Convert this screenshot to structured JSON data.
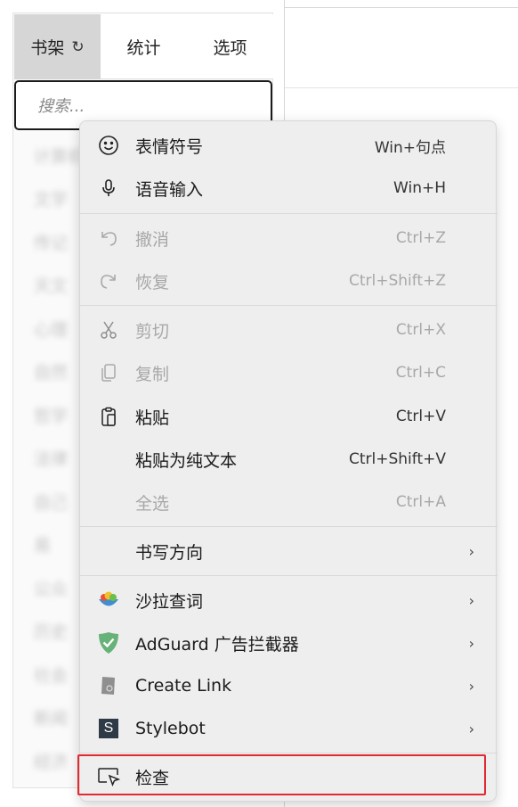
{
  "popup": {
    "tabs": [
      {
        "label": "书架",
        "refresh_glyph": "↻"
      },
      {
        "label": "统计"
      },
      {
        "label": "选项"
      }
    ],
    "search_placeholder": "搜索...",
    "list_items": [
      "计算机",
      "文学",
      "传记",
      "天文",
      "心理",
      "自然",
      "哲学",
      "法律",
      "自己",
      "易",
      "公众",
      "历史",
      "社会",
      "新闻",
      "经济"
    ]
  },
  "context_menu": {
    "items": [
      {
        "label": "表情符号",
        "shortcut": "Win+句点",
        "icon": "emoji-icon",
        "disabled": false
      },
      {
        "label": "语音输入",
        "shortcut": "Win+H",
        "icon": "microphone-icon",
        "disabled": false
      },
      {
        "label": "撤消",
        "shortcut": "Ctrl+Z",
        "icon": "undo-icon",
        "disabled": true
      },
      {
        "label": "恢复",
        "shortcut": "Ctrl+Shift+Z",
        "icon": "redo-icon",
        "disabled": true
      },
      {
        "label": "剪切",
        "shortcut": "Ctrl+X",
        "icon": "scissors-icon",
        "disabled": true
      },
      {
        "label": "复制",
        "shortcut": "Ctrl+C",
        "icon": "copy-icon",
        "disabled": true
      },
      {
        "label": "粘贴",
        "shortcut": "Ctrl+V",
        "icon": "paste-icon",
        "disabled": false
      },
      {
        "label": "粘贴为纯文本",
        "shortcut": "Ctrl+Shift+V",
        "icon": "",
        "disabled": false
      },
      {
        "label": "全选",
        "shortcut": "Ctrl+A",
        "icon": "",
        "disabled": true
      },
      {
        "label": "书写方向",
        "icon": "",
        "submenu": true
      },
      {
        "label": "沙拉查词",
        "icon": "saladict-icon",
        "submenu": true
      },
      {
        "label": "AdGuard 广告拦截器",
        "icon": "adguard-shield-icon",
        "submenu": true
      },
      {
        "label": "Create Link",
        "icon": "create-link-icon",
        "submenu": true
      },
      {
        "label": "Stylebot",
        "icon": "stylebot-icon",
        "icon_letter": "S",
        "submenu": true
      },
      {
        "label": "检查",
        "icon": "inspect-icon",
        "highlighted": true
      }
    ],
    "submenu_arrow": "›",
    "colors": {
      "highlight_border": "#e22a32",
      "adguard_green": "#67b279",
      "stylebot_bg": "#2f3a47"
    }
  }
}
